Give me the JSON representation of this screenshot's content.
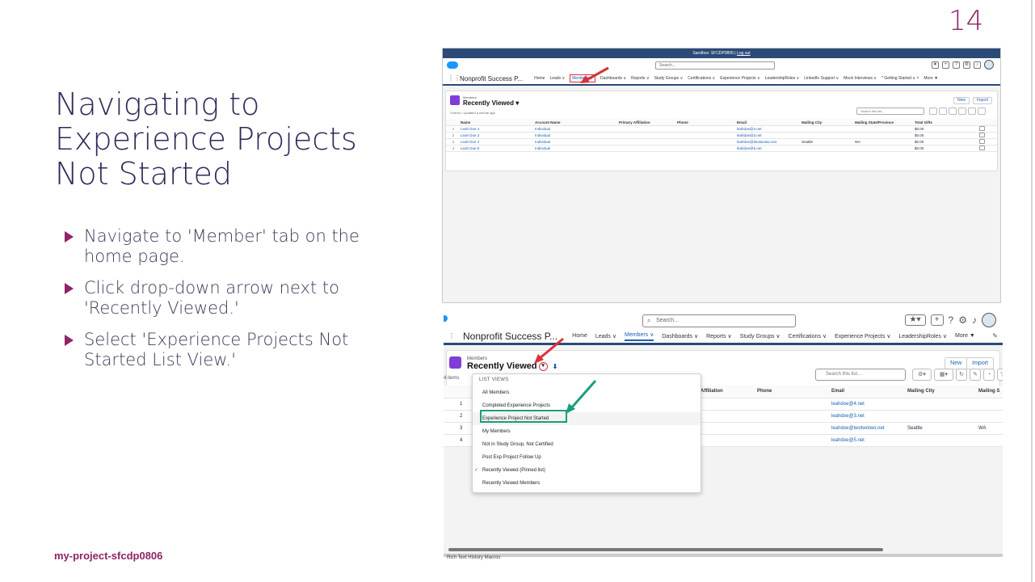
{
  "slide": {
    "number": "14",
    "title": "Navigating to Experience Projects Not Started",
    "bullets": [
      "Navigate to 'Member' tab on the home page.",
      "Click drop-down arrow next to 'Recently Viewed.'",
      "Select 'Experience Projects Not Started List View.'"
    ],
    "footer": "my-project-sfcdp0806"
  },
  "colors": {
    "accent": "#8e2466",
    "title": "#2d2a5a",
    "salesforce_blue": "#1b96ff",
    "link_blue": "#1a5fb4",
    "nav_bar": "#2a4a78",
    "highlight_red": "#d8323a",
    "highlight_green": "#1b9d7d",
    "object_icon_purple": "#7f3ed6"
  },
  "screenshot1": {
    "sandbox_banner": "Sandbox: SFCDP0806 |",
    "sandbox_logout": "Log out",
    "search_placeholder": "Search...",
    "app_name": "Nonprofit Success P...",
    "nav": [
      "Home",
      "Leads ∨",
      "Members ∨",
      "Dashboards ∨",
      "Reports ∨",
      "Study Groups ∨",
      "Certifications ∨",
      "Experience Projects ∨",
      "LeadershipRoles ∨",
      "LinkedIn Support ∨",
      "Mock Interviews ∨",
      "* Getting Started ∨ ×",
      "More ▼"
    ],
    "object_label": "Members",
    "view_title": "Recently Viewed",
    "meta": "4 items • Updated a minute ago",
    "buttons": [
      "New",
      "Import"
    ],
    "list_search": "Search this list...",
    "columns": [
      "Name",
      "Account Name",
      "Primary Affiliation",
      "Phone",
      "Email",
      "Mailing City",
      "Mailing State/Province",
      "Total Gifts"
    ],
    "rows": [
      {
        "num": "1",
        "name": "Leah Doe 4",
        "account": "Individual",
        "email": "leahdoe@4.net",
        "city": "",
        "state": "",
        "gifts": "$0.00"
      },
      {
        "num": "2",
        "name": "Leah Doe 3",
        "account": "Individual",
        "email": "leahdoe@3.net",
        "city": "",
        "state": "",
        "gifts": "$0.00"
      },
      {
        "num": "3",
        "name": "Leah Doe 2",
        "account": "Individual",
        "email": "leahdoe@twotwotwo.net",
        "city": "Seattle",
        "state": "WA",
        "gifts": "$0.00"
      },
      {
        "num": "4",
        "name": "Leah Doe 5",
        "account": "Individual",
        "email": "leahdoe@5.net",
        "city": "",
        "state": "",
        "gifts": "$0.00"
      }
    ]
  },
  "screenshot2": {
    "search_placeholder": "Search...",
    "app_name": "Nonprofit Success P...",
    "nav": [
      "Home",
      "Leads ∨",
      "Members ∨",
      "Dashboards ∨",
      "Reports ∨",
      "Study Groups ∨",
      "Certifications ∨",
      "Experience Projects ∨",
      "LeadershipRoles ∨",
      "More ▼"
    ],
    "object_label": "Members",
    "view_title": "Recently Viewed",
    "buttons": [
      "New",
      "Import"
    ],
    "list_search": "Search this list...",
    "count": "4 items",
    "columns": [
      "Affiliation",
      "Phone",
      "Email",
      "Mailing City",
      "Mailing S"
    ],
    "rows": [
      {
        "num": "1",
        "email": "leahdoe@4.net",
        "city": "",
        "state": ""
      },
      {
        "num": "2",
        "email": "leahdoe@3.net",
        "city": "",
        "state": ""
      },
      {
        "num": "3",
        "email": "leahdoe@twotwotwo.net",
        "city": "Seattle",
        "state": "WA"
      },
      {
        "num": "4",
        "email": "leahdoe@5.net",
        "city": "",
        "state": ""
      }
    ],
    "menu_header": "LIST VIEWS",
    "menu_items": [
      "All Members",
      "Completed Experience Projects",
      "Experience Project Not Started",
      "My Members",
      "Not in Study Group, Not Certified",
      "Post Exp Project Follow Up",
      "Recently Viewed (Pinned list)",
      "Recently Viewed Members"
    ],
    "utility_bar": "Rich Text   History   Macros"
  }
}
